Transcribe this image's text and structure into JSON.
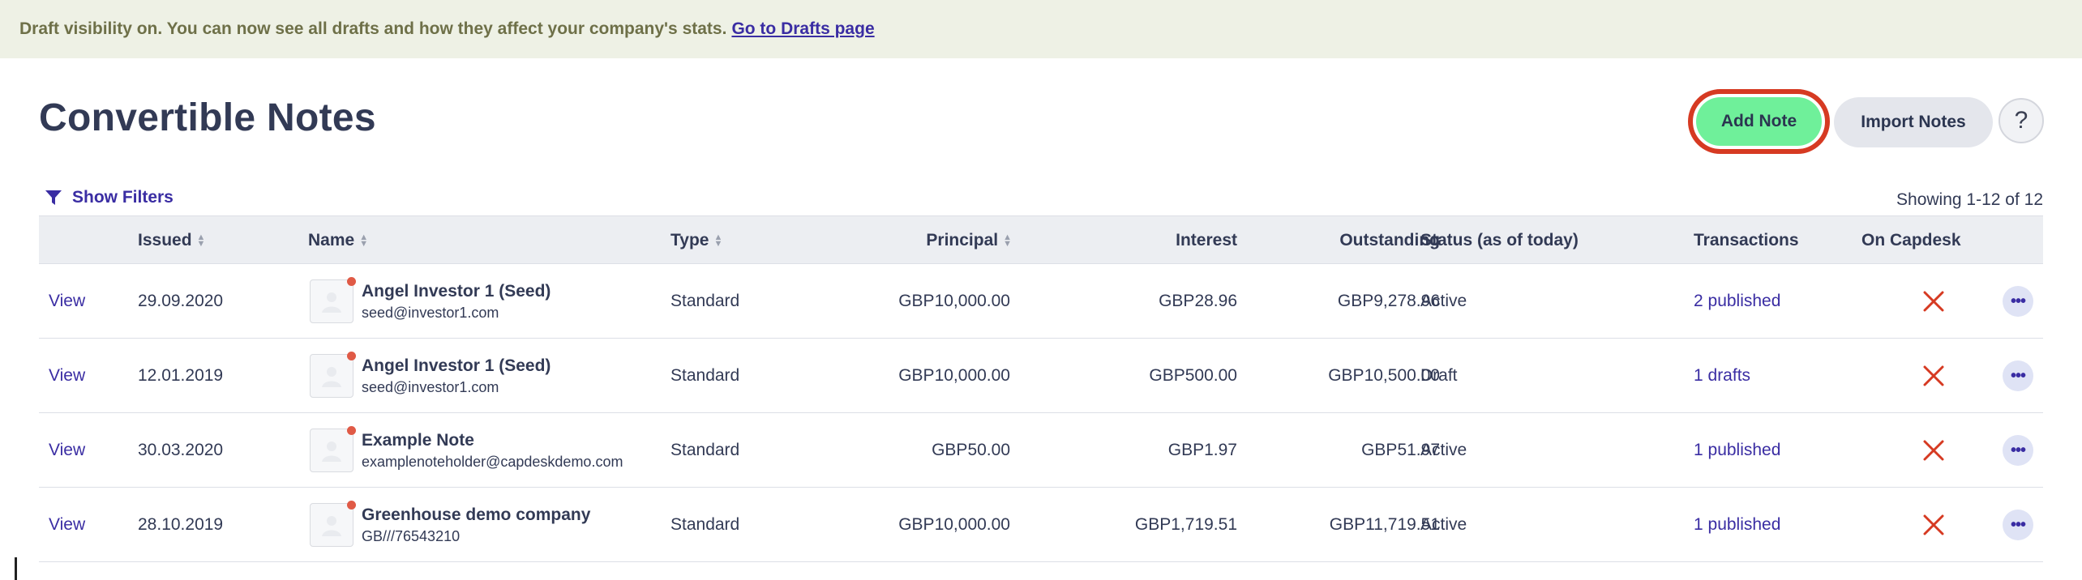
{
  "banner": {
    "text": "Draft visibility on. You can now see all drafts and how they affect your company's stats.",
    "link": "Go to Drafts page"
  },
  "header": {
    "title": "Convertible Notes",
    "add_note": "Add Note",
    "import_notes": "Import Notes",
    "help": "?"
  },
  "filters": {
    "label": "Show Filters",
    "showing": "Showing 1-12 of 12"
  },
  "table": {
    "columns": {
      "issued": "Issued",
      "name": "Name",
      "type": "Type",
      "principal": "Principal",
      "interest": "Interest",
      "outstanding": "Outstanding",
      "status": "Status (as of today)",
      "transactions": "Transactions",
      "on_capdesk": "On Capdesk"
    },
    "rows": [
      {
        "view": "View",
        "issued": "29.09.2020",
        "name": "Angel Investor 1 (Seed)",
        "sub": "seed@investor1.com",
        "type": "Standard",
        "principal": "GBP10,000.00",
        "interest": "GBP28.96",
        "outstanding": "GBP9,278.96",
        "status": "Active",
        "transactions": "2 published"
      },
      {
        "view": "View",
        "issued": "12.01.2019",
        "name": "Angel Investor 1 (Seed)",
        "sub": "seed@investor1.com",
        "type": "Standard",
        "principal": "GBP10,000.00",
        "interest": "GBP500.00",
        "outstanding": "GBP10,500.00",
        "status": "Draft",
        "transactions": "1 drafts"
      },
      {
        "view": "View",
        "issued": "30.03.2020",
        "name": "Example Note",
        "sub": "examplenoteholder@capdeskdemo.com",
        "type": "Standard",
        "principal": "GBP50.00",
        "interest": "GBP1.97",
        "outstanding": "GBP51.97",
        "status": "Active",
        "transactions": "1 published"
      },
      {
        "view": "View",
        "issued": "28.10.2019",
        "name": "Greenhouse demo company",
        "sub": "GB///76543210",
        "type": "Standard",
        "principal": "GBP10,000.00",
        "interest": "GBP1,719.51",
        "outstanding": "GBP11,719.51",
        "status": "Active",
        "transactions": "1 published"
      }
    ]
  },
  "colors": {
    "accent": "#3a2da3",
    "add_note_bg": "#6ff09a",
    "highlight_ring": "#d63a22",
    "cross": "#d63a22"
  },
  "icons": {
    "filter": "filter-icon",
    "sort": "sort-icon",
    "avatar": "avatar-icon",
    "cross": "cross-icon",
    "more": "more-icon"
  }
}
